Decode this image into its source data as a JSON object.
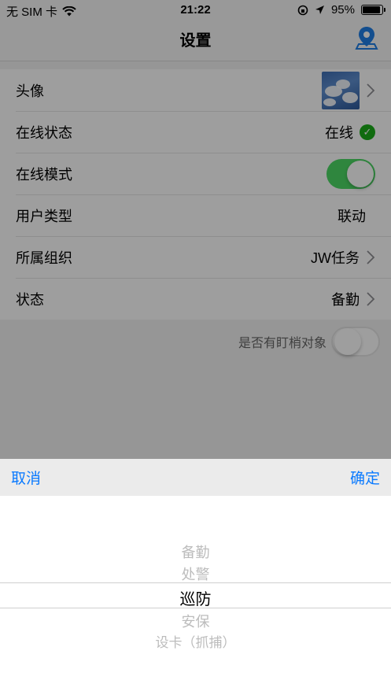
{
  "status_bar": {
    "carrier": "无 SIM 卡",
    "time": "21:22",
    "battery": "95%",
    "battery_level": 0.95
  },
  "nav": {
    "title": "设置",
    "right_icon": "location-pin-icon"
  },
  "rows": [
    {
      "label": "头像",
      "value": ""
    },
    {
      "label": "在线状态",
      "value": "在线"
    },
    {
      "label": "在线模式",
      "value": ""
    },
    {
      "label": "用户类型",
      "value": "联动"
    },
    {
      "label": "所属组织",
      "value": "JW任务"
    },
    {
      "label": "状态",
      "value": "备勤"
    }
  ],
  "stalk_label": "是否有盯梢对象",
  "picker": {
    "cancel": "取消",
    "confirm": "确定",
    "options": [
      "备勤",
      "处警",
      "巡防",
      "安保",
      "设卡（抓捕）"
    ],
    "selected": "巡防"
  },
  "colors": {
    "accent": "#0a7aff",
    "toggle_on": "#4cd964",
    "online_green": "#1aad19"
  }
}
